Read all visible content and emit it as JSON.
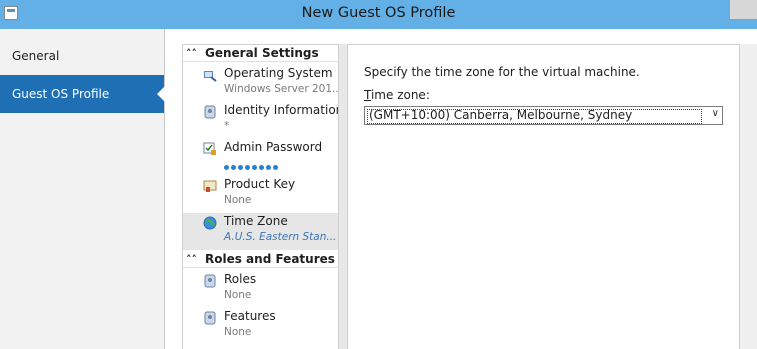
{
  "window": {
    "title": "New Guest OS Profile"
  },
  "nav": {
    "items": [
      {
        "label": "General",
        "selected": false
      },
      {
        "label": "Guest OS Profile",
        "selected": true
      }
    ]
  },
  "settings": {
    "groups": [
      {
        "title": "General Settings",
        "items": [
          {
            "label": "Operating System",
            "value": "Windows Server 201..."
          },
          {
            "label": "Identity Information",
            "value": "*"
          },
          {
            "label": "Admin Password",
            "value": ""
          },
          {
            "label": "Product Key",
            "value": "None"
          },
          {
            "label": "Time Zone",
            "value": "A.U.S. Eastern Stan..."
          }
        ]
      },
      {
        "title": "Roles and Features",
        "items": [
          {
            "label": "Roles",
            "value": "None"
          },
          {
            "label": "Features",
            "value": "None"
          }
        ]
      }
    ]
  },
  "content": {
    "description": "Specify the time zone for the virtual machine.",
    "field_label_accesskey": "T",
    "field_label_rest": "ime zone:",
    "timezone_value": "(GMT+10:00) Canberra, Melbourne, Sydney"
  },
  "colors": {
    "titlebar": "#62b0e6",
    "nav_selected": "#1f6fb5",
    "accent_text": "#3a76b6"
  }
}
